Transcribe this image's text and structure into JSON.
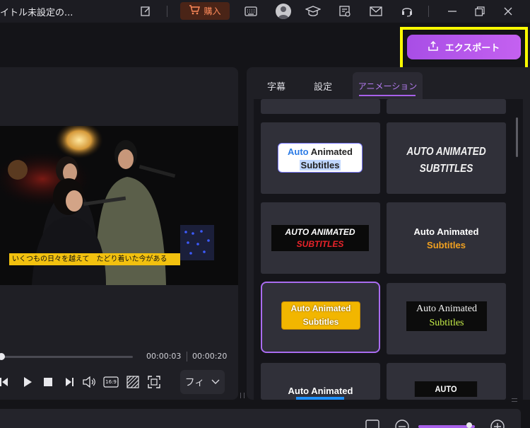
{
  "titlebar": {
    "title": "イトル未設定の...",
    "buy_label": "購入",
    "icons": [
      "edit-icon",
      "cart-icon",
      "keyboard-icon",
      "account-icon",
      "learn-icon",
      "tools-icon",
      "mail-icon",
      "support-icon",
      "minimize-icon",
      "restore-icon",
      "close-icon"
    ]
  },
  "toolbar": {
    "export_label": "エクスポート",
    "export_highlight_color": "#ffff00",
    "accent_color": "#b25cf0"
  },
  "preview": {
    "subtitle_text": "いくつもの日々を越えて　たどり着いた今がある",
    "subtitle_bg": "#f2c10f",
    "current_time": "00:00:03",
    "total_time": "00:00:20",
    "progress": 0.0,
    "fit_label": "フィ",
    "aspect_ratio_label": "16:9",
    "controls": [
      "prev-frame-icon",
      "play-icon",
      "stop-icon",
      "next-frame-icon",
      "volume-icon",
      "aspect-ratio-icon",
      "quality-icon",
      "fullscreen-icon"
    ]
  },
  "right_panel": {
    "tabs": [
      {
        "label": "字幕",
        "active": false
      },
      {
        "label": "設定",
        "active": false
      },
      {
        "label": "アニメーション",
        "active": true
      }
    ],
    "styles": [
      {
        "line1": "Auto",
        "line1b": "Animated",
        "line2": "Subtitles"
      },
      {
        "line1": "AUTO ANIMATED",
        "line2": "SUBTITLES"
      },
      {
        "line1": "AUTO ANIMATED",
        "line2": "SUBTITLES"
      },
      {
        "line1": "Auto Animated",
        "line2": "Subtitles"
      },
      {
        "line1": "Auto Animated",
        "line2": "Subtitles",
        "selected": true
      },
      {
        "line1": "Auto Animated",
        "line2": "Subtitles"
      },
      {
        "line1": "Auto Animated"
      },
      {
        "line1": "AUTO ANIMATED"
      }
    ]
  }
}
